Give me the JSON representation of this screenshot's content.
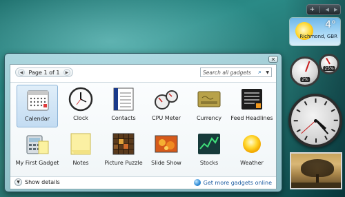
{
  "sidebar": {
    "controls": {
      "add": "+",
      "prev": "◀",
      "next": "▶"
    },
    "weather": {
      "temperature": "4°",
      "location": "Richmond, GBR"
    },
    "cpu_meter": {
      "cpu": "2%",
      "memory": "25%"
    },
    "clock_time": {
      "hour": 4,
      "minute": 23,
      "second": 38
    }
  },
  "gallery": {
    "close_glyph": "✕",
    "pager": {
      "label": "Page 1 of 1",
      "prev": "◀",
      "next": "▶"
    },
    "search": {
      "placeholder": "Search all gadgets",
      "icon": "⌕",
      "dropdown": "▼"
    },
    "gadgets": [
      {
        "label": "Calendar",
        "icon": "calendar-icon",
        "selected": true
      },
      {
        "label": "Clock",
        "icon": "clock-icon"
      },
      {
        "label": "Contacts",
        "icon": "contacts-icon"
      },
      {
        "label": "CPU Meter",
        "icon": "cpu-meter-icon"
      },
      {
        "label": "Currency",
        "icon": "currency-icon"
      },
      {
        "label": "Feed Headlines",
        "icon": "feed-headlines-icon"
      },
      {
        "label": "My First Gadget",
        "icon": "my-first-gadget-icon"
      },
      {
        "label": "Notes",
        "icon": "notes-icon"
      },
      {
        "label": "Picture Puzzle",
        "icon": "picture-puzzle-icon"
      },
      {
        "label": "Slide Show",
        "icon": "slide-show-icon"
      },
      {
        "label": "Stocks",
        "icon": "stocks-icon"
      },
      {
        "label": "Weather",
        "icon": "weather-icon"
      }
    ],
    "footer": {
      "show_details": "Show details",
      "show_details_glyph": "▼",
      "get_more": "Get more gadgets online"
    }
  }
}
